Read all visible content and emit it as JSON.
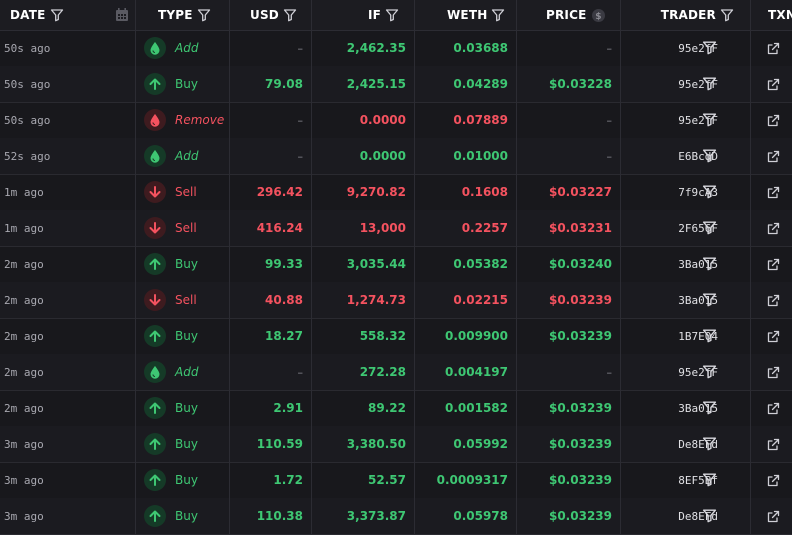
{
  "colors": {
    "buy": "#3ec773",
    "sell": "#f4525f",
    "background": "#18181c",
    "header_background": "#1c1c21"
  },
  "header": {
    "date": "DATE",
    "type": "TYPE",
    "usd": "USD",
    "if": "IF",
    "weth": "WETH",
    "price": "PRICE",
    "trader": "TRADER",
    "txn": "TXN"
  },
  "rows": [
    {
      "date": "50s ago",
      "type": "Add",
      "kind": "add",
      "usd": "–",
      "if": "2,462.35",
      "weth": "0.03688",
      "price": "–",
      "trader": "95e2fF"
    },
    {
      "date": "50s ago",
      "type": "Buy",
      "kind": "buy",
      "usd": "79.08",
      "if": "2,425.15",
      "weth": "0.04289",
      "price": "$0.03228",
      "trader": "95e2fF"
    },
    {
      "date": "50s ago",
      "type": "Remove",
      "kind": "remove",
      "usd": "–",
      "if": "0.0000",
      "weth": "0.07889",
      "price": "–",
      "trader": "95e2fF"
    },
    {
      "date": "52s ago",
      "type": "Add",
      "kind": "add",
      "usd": "–",
      "if": "0.0000",
      "weth": "0.01000",
      "price": "–",
      "trader": "E6BcdD"
    },
    {
      "date": "1m ago",
      "type": "Sell",
      "kind": "sell",
      "usd": "296.42",
      "if": "9,270.82",
      "weth": "0.1608",
      "price": "$0.03227",
      "trader": "7f9cA3"
    },
    {
      "date": "1m ago",
      "type": "Sell",
      "kind": "sell",
      "usd": "416.24",
      "if": "13,000",
      "weth": "0.2257",
      "price": "$0.03231",
      "trader": "2F656F"
    },
    {
      "date": "2m ago",
      "type": "Buy",
      "kind": "buy",
      "usd": "99.33",
      "if": "3,035.44",
      "weth": "0.05382",
      "price": "$0.03240",
      "trader": "3Ba015"
    },
    {
      "date": "2m ago",
      "type": "Sell",
      "kind": "sell",
      "usd": "40.88",
      "if": "1,274.73",
      "weth": "0.02215",
      "price": "$0.03239",
      "trader": "3Ba015"
    },
    {
      "date": "2m ago",
      "type": "Buy",
      "kind": "buy",
      "usd": "18.27",
      "if": "558.32",
      "weth": "0.009900",
      "price": "$0.03239",
      "trader": "1B7E04"
    },
    {
      "date": "2m ago",
      "type": "Add",
      "kind": "add",
      "usd": "–",
      "if": "272.28",
      "weth": "0.004197",
      "price": "–",
      "trader": "95e2fF"
    },
    {
      "date": "2m ago",
      "type": "Buy",
      "kind": "buy",
      "usd": "2.91",
      "if": "89.22",
      "weth": "0.001582",
      "price": "$0.03239",
      "trader": "3Ba015"
    },
    {
      "date": "3m ago",
      "type": "Buy",
      "kind": "buy",
      "usd": "110.59",
      "if": "3,380.50",
      "weth": "0.05992",
      "price": "$0.03239",
      "trader": "De8EFd"
    },
    {
      "date": "3m ago",
      "type": "Buy",
      "kind": "buy",
      "usd": "1.72",
      "if": "52.57",
      "weth": "0.0009317",
      "price": "$0.03239",
      "trader": "8EF5Bf"
    },
    {
      "date": "3m ago",
      "type": "Buy",
      "kind": "buy",
      "usd": "110.38",
      "if": "3,373.87",
      "weth": "0.05978",
      "price": "$0.03239",
      "trader": "De8EFd"
    }
  ]
}
